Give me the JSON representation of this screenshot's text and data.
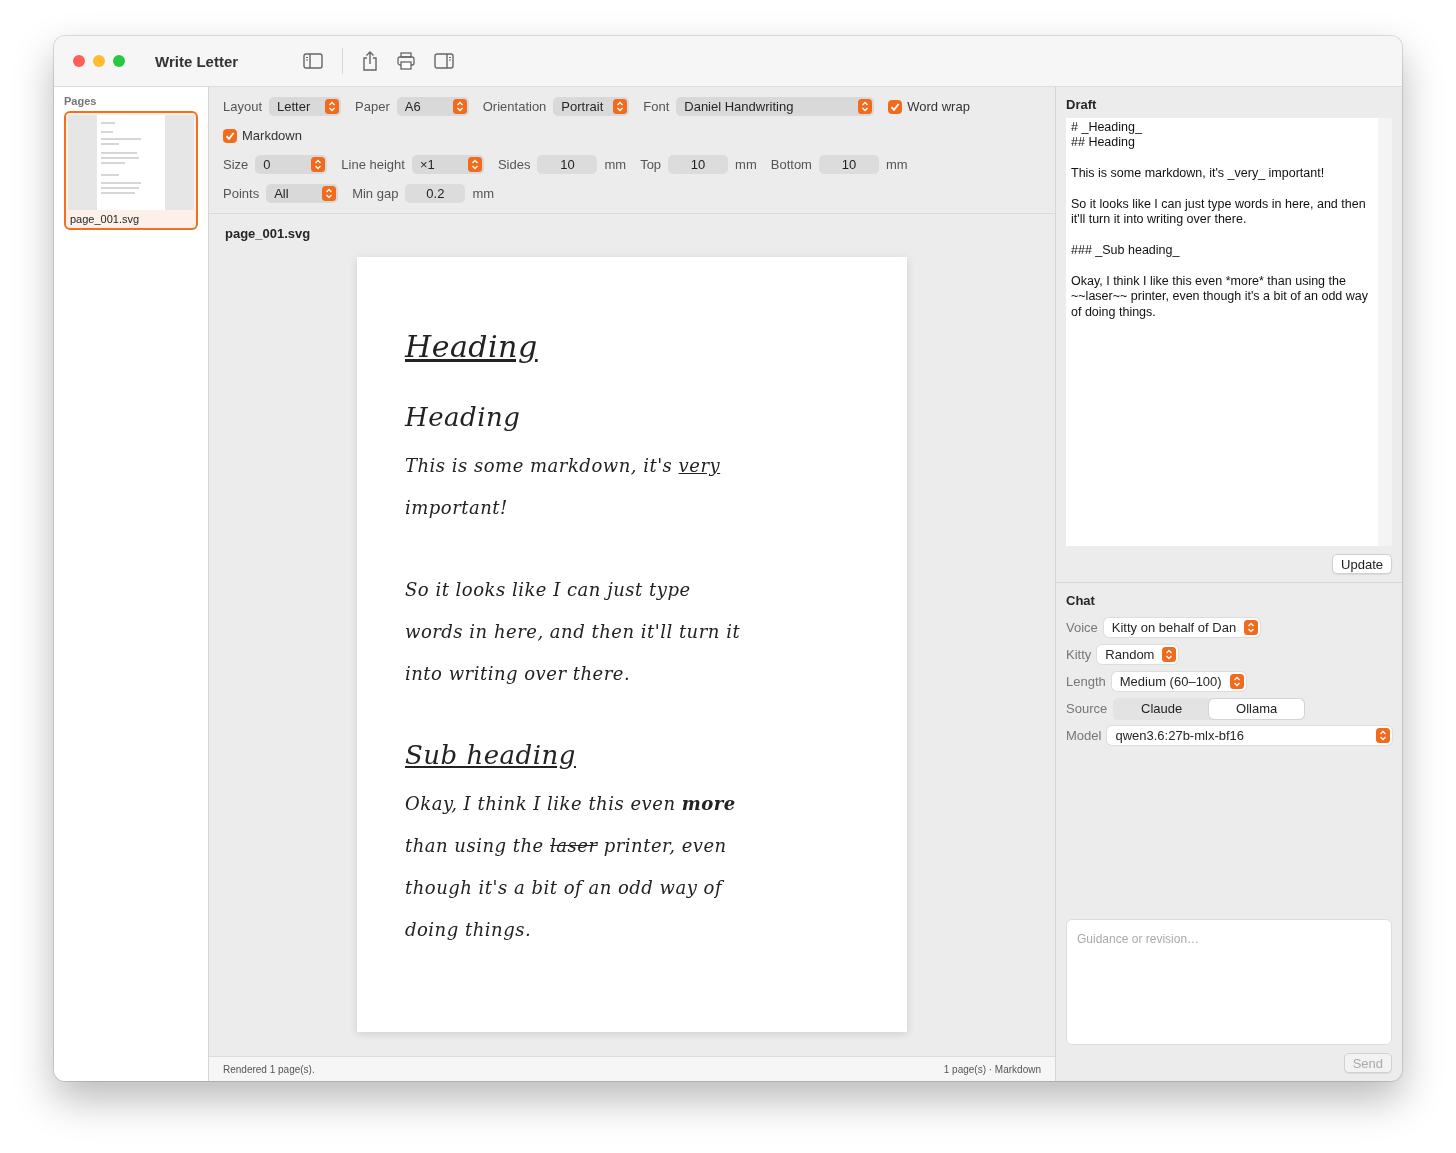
{
  "window": {
    "title": "Write Letter"
  },
  "sidebar": {
    "title": "Pages",
    "pages": [
      {
        "name": "page_001.svg",
        "selected": true
      }
    ]
  },
  "settings_rows": [
    [
      {
        "kind": "popup",
        "label": "Layout",
        "value": "Letter"
      },
      {
        "kind": "popup",
        "label": "Paper",
        "value": "A6"
      },
      {
        "kind": "popup",
        "label": "Orientation",
        "value": "Portrait"
      },
      {
        "kind": "popup",
        "label": "Font",
        "value": "Daniel Handwriting"
      },
      {
        "kind": "checkbox",
        "label": "Word wrap",
        "checked": true
      }
    ],
    [
      {
        "kind": "checkbox",
        "label": "Markdown",
        "checked": true
      }
    ],
    [
      {
        "kind": "popup",
        "label": "Size",
        "value": "0"
      },
      {
        "kind": "popup",
        "label": "Line height",
        "value": "×1"
      },
      {
        "kind": "number",
        "label": "Sides",
        "value": "10",
        "unit": "mm"
      },
      {
        "kind": "number",
        "label": "Top",
        "value": "10",
        "unit": "mm"
      },
      {
        "kind": "number",
        "label": "Bottom",
        "value": "10",
        "unit": "mm"
      }
    ],
    [
      {
        "kind": "popup",
        "label": "Points",
        "value": "All"
      },
      {
        "kind": "number",
        "label": "Min gap",
        "value": "0.2",
        "unit": "mm"
      }
    ]
  ],
  "preview": {
    "title": "page_001.svg",
    "blocks": [
      {
        "kind": "h1",
        "lines": [
          [
            {
              "text": "Heading",
              "kind": "emphasis"
            }
          ]
        ]
      },
      {
        "kind": "h2",
        "lines": [
          [
            {
              "text": "Heading",
              "kind": "normal"
            }
          ]
        ]
      },
      {
        "kind": "text",
        "lines": [
          [
            {
              "text": "This is some markdown, it's ",
              "kind": "normal"
            },
            {
              "text": "very",
              "kind": "emphasis"
            }
          ],
          [
            {
              "text": "important!",
              "kind": "normal"
            }
          ]
        ]
      },
      {
        "kind": "text",
        "lines": [
          [
            {
              "text": "So it looks like I can just type",
              "kind": "normal"
            }
          ],
          [
            {
              "text": "words in here, and then it'll turn it",
              "kind": "normal"
            }
          ],
          [
            {
              "text": "into writing over there.",
              "kind": "normal"
            }
          ]
        ]
      },
      {
        "kind": "h3",
        "lines": [
          [
            {
              "text": "Sub heading",
              "kind": "emphasis"
            }
          ]
        ]
      },
      {
        "kind": "text",
        "lines": [
          [
            {
              "text": "Okay, I think I like this even ",
              "kind": "normal"
            },
            {
              "text": "more",
              "kind": "strong"
            }
          ],
          [
            {
              "text": "than using the ",
              "kind": "normal"
            },
            {
              "text": "laser",
              "kind": "deleted"
            },
            {
              "text": " printer, even",
              "kind": "normal"
            }
          ],
          [
            {
              "text": "though it's a bit of an odd way of",
              "kind": "normal"
            }
          ],
          [
            {
              "text": "doing things.",
              "kind": "normal"
            }
          ]
        ]
      }
    ]
  },
  "status_bar": {
    "left": "Rendered 1 page(s).",
    "right": "1 page(s) · Markdown"
  },
  "draft": {
    "title": "Draft",
    "value": "# _Heading_\n## Heading\n\nThis is some markdown, it's _very_ important!\n\nSo it looks like I can just type words in here, and then it'll turn it into writing over there.\n\n### _Sub heading_\n\nOkay, I think I like this even *more* than using the ~~laser~~ printer, even though it's a bit of an odd way of doing things.\n",
    "button": "Update"
  },
  "chat": {
    "title": "Chat",
    "fields": [
      {
        "kind": "popup",
        "label": "Voice",
        "value": "Kitty on behalf of Dan"
      },
      {
        "kind": "popup",
        "label": "Kitty",
        "value": "Random"
      },
      {
        "kind": "popup",
        "label": "Length",
        "value": "Medium (60–100)"
      },
      {
        "kind": "segmented",
        "label": "Source",
        "options": [
          {
            "label": "Claude",
            "selected": false
          },
          {
            "label": "Ollama",
            "selected": true
          }
        ]
      },
      {
        "kind": "popup",
        "label": "Model",
        "value": "qwen3.6:27b-mlx-bf16"
      }
    ],
    "input": {
      "placeholder": "Guidance or revision…"
    },
    "send": "Send"
  }
}
